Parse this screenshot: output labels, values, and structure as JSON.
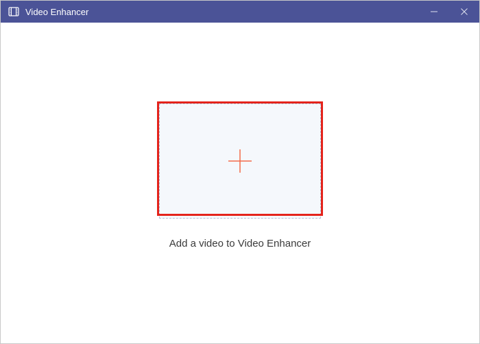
{
  "titlebar": {
    "app_title": "Video Enhancer"
  },
  "main": {
    "instruction": "Add a video to Video Enhancer"
  },
  "colors": {
    "titlebar_bg": "#4b5397",
    "highlight": "#e4231b",
    "plus": "#f46a4a",
    "dropzone_bg": "#f5f8fc"
  }
}
